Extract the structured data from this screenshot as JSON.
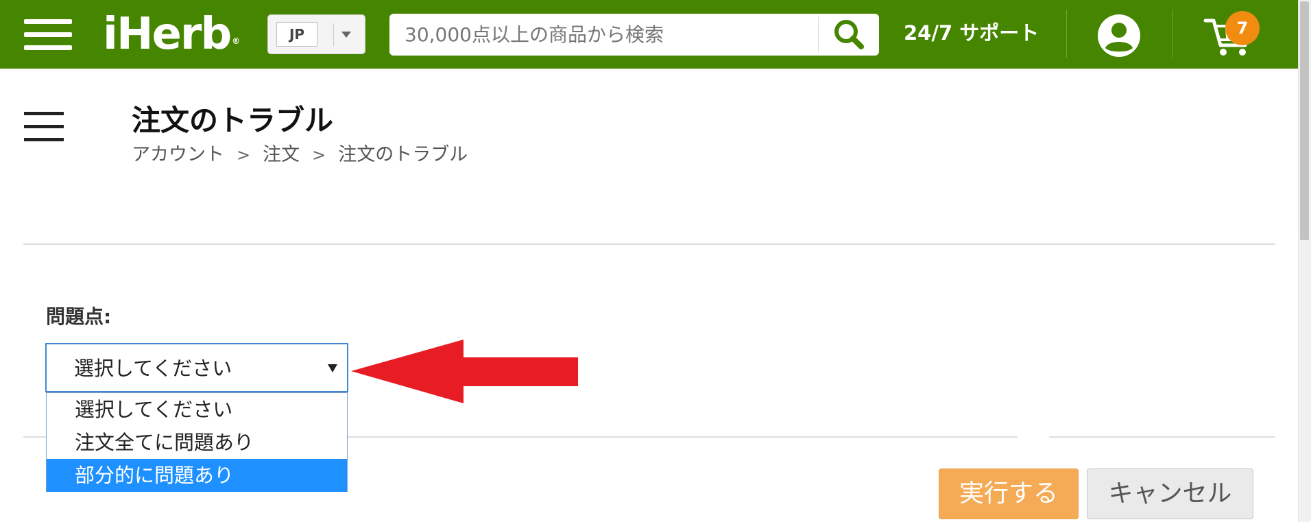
{
  "header": {
    "logo_text": "iHerb",
    "logo_mark": "®",
    "country_code": "JP",
    "search_placeholder": "30,000点以上の商品から検索",
    "support_label": "24/7 サポート",
    "cart_count": "7",
    "colors": {
      "bar": "#458500",
      "badge": "#f28c10"
    }
  },
  "page": {
    "title": "注文のトラブル",
    "breadcrumb": [
      "アカウント",
      "注文",
      "注文のトラブル"
    ],
    "breadcrumb_separator": ">"
  },
  "form": {
    "issue_label": "問題点:",
    "select_value": "選択してください",
    "options": [
      {
        "label": "選択してください",
        "selected": false
      },
      {
        "label": "注文全てに問題あり",
        "selected": false
      },
      {
        "label": "部分的に問題あり",
        "selected": true
      }
    ],
    "submit_label": "実行する",
    "cancel_label": "キャンセル",
    "colors": {
      "submit": "#f5ab56",
      "option_highlight": "#1e90ff",
      "annotation_arrow": "#e81c24"
    }
  }
}
